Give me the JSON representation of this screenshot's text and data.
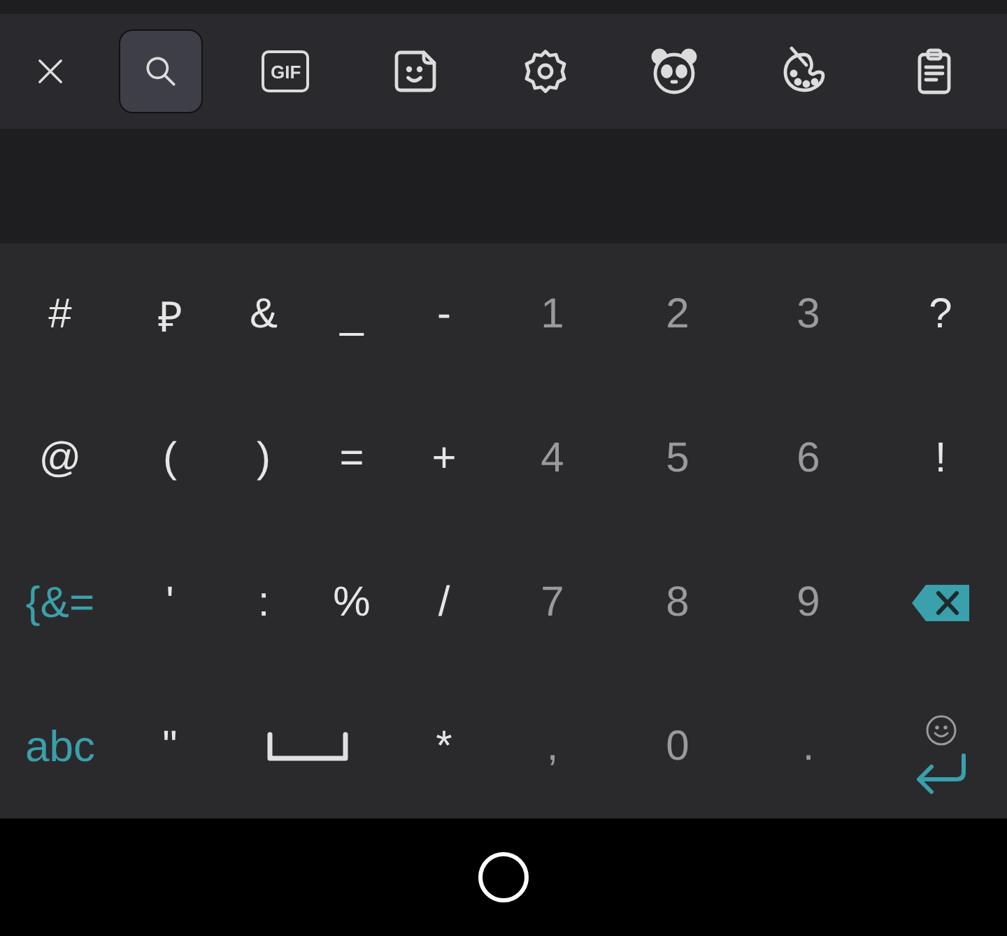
{
  "toolbar": [
    {
      "kind": "close",
      "selected": false
    },
    {
      "kind": "search",
      "selected": true
    },
    {
      "kind": "gif",
      "label": "GIF",
      "selected": false
    },
    {
      "kind": "sticker",
      "selected": false
    },
    {
      "kind": "settings",
      "selected": false
    },
    {
      "kind": "panda",
      "selected": false
    },
    {
      "kind": "palette",
      "selected": false
    },
    {
      "kind": "clipboard",
      "selected": false
    }
  ],
  "keyboard": {
    "rows": [
      [
        {
          "kind": "char",
          "label": "#"
        },
        {
          "kind": "char",
          "label": "₽"
        },
        {
          "kind": "char",
          "label": "&"
        },
        {
          "kind": "char",
          "label": "_"
        },
        {
          "kind": "char",
          "label": "-"
        },
        {
          "kind": "digit",
          "label": "1"
        },
        {
          "kind": "digit",
          "label": "2"
        },
        {
          "kind": "digit",
          "label": "3"
        },
        {
          "kind": "char",
          "label": "?"
        }
      ],
      [
        {
          "kind": "char",
          "label": "@"
        },
        {
          "kind": "char",
          "label": "("
        },
        {
          "kind": "char",
          "label": ")"
        },
        {
          "kind": "char",
          "label": "="
        },
        {
          "kind": "char",
          "label": "+"
        },
        {
          "kind": "digit",
          "label": "4"
        },
        {
          "kind": "digit",
          "label": "5"
        },
        {
          "kind": "digit",
          "label": "6"
        },
        {
          "kind": "char",
          "label": "!"
        }
      ],
      [
        {
          "kind": "mode",
          "label": "{&="
        },
        {
          "kind": "char",
          "label": "'"
        },
        {
          "kind": "char",
          "label": ":"
        },
        {
          "kind": "char",
          "label": "%"
        },
        {
          "kind": "char",
          "label": "/"
        },
        {
          "kind": "digit",
          "label": "7"
        },
        {
          "kind": "digit",
          "label": "8"
        },
        {
          "kind": "digit",
          "label": "9"
        },
        {
          "kind": "backspace"
        }
      ],
      [
        {
          "kind": "mode",
          "label": "abc"
        },
        {
          "kind": "char",
          "label": "\""
        },
        {
          "kind": "space"
        },
        "",
        {
          "kind": "char",
          "label": "*"
        },
        {
          "kind": "digit",
          "label": ","
        },
        {
          "kind": "digit",
          "label": "0"
        },
        {
          "kind": "digit",
          "label": "."
        },
        {
          "kind": "enter"
        }
      ]
    ]
  }
}
